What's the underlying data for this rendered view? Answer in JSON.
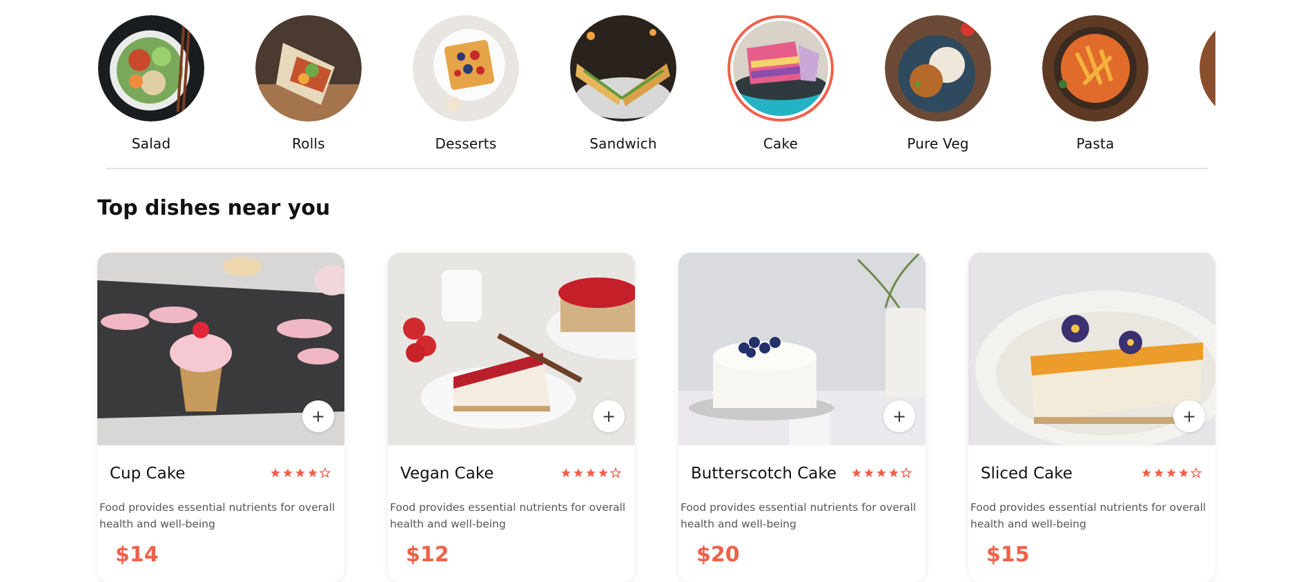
{
  "categories": [
    {
      "label": "Salad",
      "active": false
    },
    {
      "label": "Rolls",
      "active": false
    },
    {
      "label": "Desserts",
      "active": false
    },
    {
      "label": "Sandwich",
      "active": false
    },
    {
      "label": "Cake",
      "active": true
    },
    {
      "label": "Pure Veg",
      "active": false
    },
    {
      "label": "Pasta",
      "active": false
    }
  ],
  "section": {
    "title": "Top dishes near you"
  },
  "dishes": [
    {
      "name": "Cup Cake",
      "description": "Food provides essential nutrients for overall health and well-being",
      "price": "$14",
      "rating": 4,
      "rating_max": 5
    },
    {
      "name": "Vegan Cake",
      "description": "Food provides essential nutrients for overall health and well-being",
      "price": "$12",
      "rating": 4,
      "rating_max": 5
    },
    {
      "name": "Butterscotch Cake",
      "description": "Food provides essential nutrients for overall health and well-being",
      "price": "$20",
      "rating": 4,
      "rating_max": 5
    },
    {
      "name": "Sliced Cake",
      "description": "Food provides essential nutrients for overall health and well-being",
      "price": "$15",
      "rating": 4,
      "rating_max": 5
    }
  ],
  "colors": {
    "accent": "#f1604a",
    "title": "#111111",
    "muted": "#555555"
  },
  "icons": {
    "add": "plus-icon",
    "star_full": "star-filled-icon",
    "star_empty": "star-outline-icon"
  }
}
